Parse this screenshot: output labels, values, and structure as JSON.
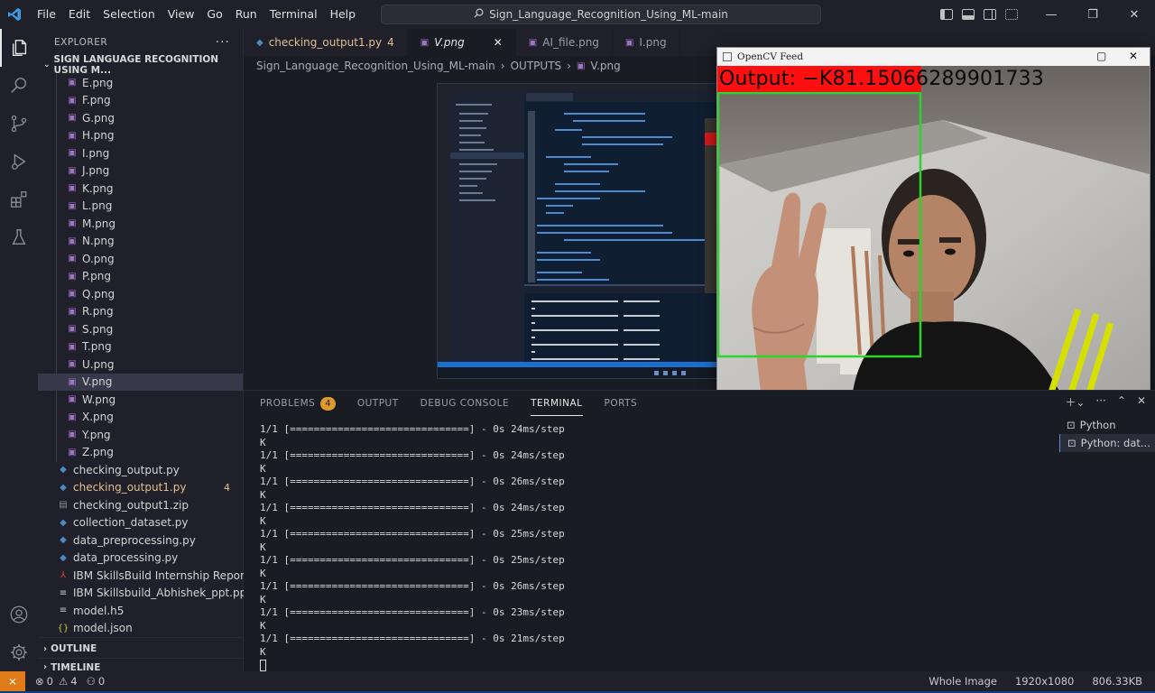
{
  "menu": [
    "File",
    "Edit",
    "Selection",
    "View",
    "Go",
    "Run",
    "Terminal",
    "Help"
  ],
  "search": {
    "text": "Sign_Language_Recognition_Using_ML-main"
  },
  "explorer": {
    "title": "EXPLORER",
    "root": "SIGN LANGUAGE RECOGNITION USING M...",
    "files": [
      {
        "name": "E.png",
        "type": "png"
      },
      {
        "name": "F.png",
        "type": "png"
      },
      {
        "name": "G.png",
        "type": "png"
      },
      {
        "name": "H.png",
        "type": "png"
      },
      {
        "name": "I.png",
        "type": "png"
      },
      {
        "name": "J.png",
        "type": "png"
      },
      {
        "name": "K.png",
        "type": "png"
      },
      {
        "name": "L.png",
        "type": "png"
      },
      {
        "name": "M.png",
        "type": "png"
      },
      {
        "name": "N.png",
        "type": "png"
      },
      {
        "name": "O.png",
        "type": "png"
      },
      {
        "name": "P.png",
        "type": "png"
      },
      {
        "name": "Q.png",
        "type": "png"
      },
      {
        "name": "R.png",
        "type": "png"
      },
      {
        "name": "S.png",
        "type": "png"
      },
      {
        "name": "T.png",
        "type": "png"
      },
      {
        "name": "U.png",
        "type": "png"
      },
      {
        "name": "V.png",
        "type": "png"
      },
      {
        "name": "W.png",
        "type": "png"
      },
      {
        "name": "X.png",
        "type": "png"
      },
      {
        "name": "Y.png",
        "type": "png"
      },
      {
        "name": "Z.png",
        "type": "png"
      },
      {
        "name": "checking_output.py",
        "type": "py"
      },
      {
        "name": "checking_output1.py",
        "type": "py",
        "badge": "4"
      },
      {
        "name": "checking_output1.zip",
        "type": "zip"
      },
      {
        "name": "collection_dataset.py",
        "type": "py"
      },
      {
        "name": "data_preprocessing.py",
        "type": "py"
      },
      {
        "name": "data_processing.py",
        "type": "py"
      },
      {
        "name": "IBM SkillsBuild Internship Report.pdf",
        "type": "pdf"
      },
      {
        "name": "IBM Skillsbuild_Abhishek_ppt.pptx",
        "type": "pptx"
      },
      {
        "name": "model.h5",
        "type": "h5"
      },
      {
        "name": "model.json",
        "type": "json"
      }
    ],
    "outline": "OUTLINE",
    "timeline": "TIMELINE"
  },
  "tabs": [
    {
      "label": "checking_output1.py",
      "badge": "4"
    },
    {
      "label": "V.png"
    },
    {
      "label": "AI_file.png"
    },
    {
      "label": "I.png"
    }
  ],
  "breadcrumb": [
    "Sign_Language_Recognition_Using_ML-main",
    "OUTPUTS",
    "V.png"
  ],
  "panel": {
    "tabs": [
      "PROBLEMS",
      "OUTPUT",
      "DEBUG CONSOLE",
      "TERMINAL",
      "PORTS"
    ],
    "problems_count": "4",
    "terminal_lines": [
      {
        "progress": "1/1 [==============================] - 0s 24ms/step",
        "out": "K"
      },
      {
        "progress": "1/1 [==============================] - 0s 24ms/step",
        "out": "K"
      },
      {
        "progress": "1/1 [==============================] - 0s 26ms/step",
        "out": "K"
      },
      {
        "progress": "1/1 [==============================] - 0s 24ms/step",
        "out": "K"
      },
      {
        "progress": "1/1 [==============================] - 0s 25ms/step",
        "out": "K"
      },
      {
        "progress": "1/1 [==============================] - 0s 25ms/step",
        "out": "K"
      },
      {
        "progress": "1/1 [==============================] - 0s 26ms/step",
        "out": "K"
      },
      {
        "progress": "1/1 [==============================] - 0s 23ms/step",
        "out": "K"
      },
      {
        "progress": "1/1 [==============================] - 0s 21ms/step",
        "out": "K"
      }
    ],
    "terminals": [
      "Python",
      "Python: dat..."
    ]
  },
  "opencv": {
    "title": "OpenCV Feed",
    "output_text": "Output:  −K81.15066289901733"
  },
  "status": {
    "errors": "0",
    "warnings": "4",
    "ports": "0",
    "view": "Whole Image",
    "dimensions": "1920x1080",
    "size": "806.33KB"
  },
  "colors": {
    "accent": "#3d9be9",
    "modified": "#e2c08d",
    "remote": "#e07b1a",
    "cv_box": "#2bd42b",
    "cv_label_bg": "#ff1010"
  }
}
